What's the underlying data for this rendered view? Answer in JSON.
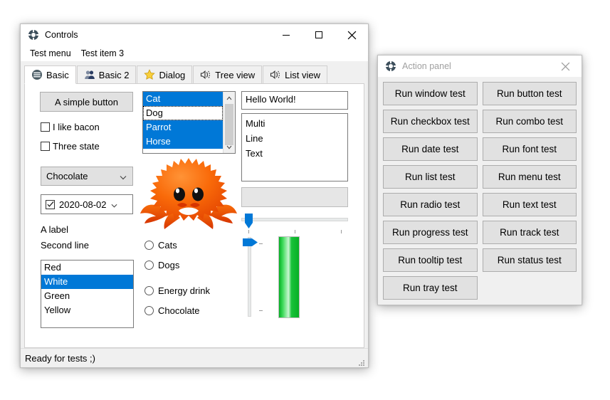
{
  "controls_window": {
    "title": "Controls",
    "title_icon": "gear-icon",
    "window_buttons": {
      "minimize": "minimize-icon",
      "maximize": "maximize-icon",
      "close": "close-icon"
    },
    "menu": [
      {
        "label": "Test menu"
      },
      {
        "label": "Test item 3"
      }
    ],
    "tabs": [
      {
        "label": "Basic",
        "icon": "layers-circle-icon",
        "active": true
      },
      {
        "label": "Basic 2",
        "icon": "people-icon",
        "active": false
      },
      {
        "label": "Dialog",
        "icon": "star-icon",
        "active": false
      },
      {
        "label": "Tree view",
        "icon": "speaker-icon",
        "active": false
      },
      {
        "label": "List view",
        "icon": "speaker-icon",
        "active": false
      }
    ],
    "basic_tab": {
      "push_button": {
        "label": "A simple button"
      },
      "checkboxes": [
        {
          "label": "I like bacon",
          "checked": false
        },
        {
          "label": "Three state",
          "checked": false
        }
      ],
      "combo": {
        "value": "Chocolate",
        "icon": "chevron-down-icon"
      },
      "date_picker": {
        "value": "2020-08-02",
        "checked": true,
        "icon": "chevron-down-icon"
      },
      "labels": [
        {
          "text": "A label"
        },
        {
          "text": "Second line"
        }
      ],
      "animal_list": {
        "items": [
          {
            "label": "Cat",
            "selected": true,
            "focused": false
          },
          {
            "label": "Dog",
            "selected": false,
            "focused": true
          },
          {
            "label": "Parrot",
            "selected": true,
            "focused": false
          },
          {
            "label": "Horse",
            "selected": true,
            "focused": false
          }
        ],
        "scroll_up_icon": "chevron-up-icon",
        "scroll_down_icon": "chevron-down-icon"
      },
      "color_list": {
        "items": [
          {
            "label": "Red",
            "selected": false
          },
          {
            "label": "White",
            "selected": true
          },
          {
            "label": "Green",
            "selected": false
          },
          {
            "label": "Yellow",
            "selected": false
          }
        ]
      },
      "radios": [
        {
          "label": "Cats",
          "checked": false
        },
        {
          "label": "Dogs",
          "checked": false
        },
        {
          "label": "Energy drink",
          "checked": false
        },
        {
          "label": "Chocolate",
          "checked": false
        }
      ],
      "text_field": {
        "value": "Hello World!",
        "placeholder": ""
      },
      "text_area": {
        "value": "Multi\nLine\nText",
        "placeholder": ""
      },
      "progress_bar_horizontal": {
        "percent": 0
      },
      "slider_horizontal": {
        "percent": 3
      },
      "slider_vertical": {
        "percent": 100
      },
      "progress_bar_vertical": {
        "percent": 100,
        "color": "#06b025"
      },
      "image": {
        "name": "ferris-crab-image",
        "color": "#f74c00"
      }
    },
    "statusbar": {
      "text": "Ready for tests ;)",
      "grip_icon": "resize-grip-icon"
    }
  },
  "action_panel": {
    "title": "Action panel",
    "title_icon": "gear-icon",
    "active": false,
    "window_buttons": {
      "close": "close-icon"
    },
    "buttons": [
      {
        "label": "Run window test"
      },
      {
        "label": "Run button test"
      },
      {
        "label": "Run checkbox test"
      },
      {
        "label": "Run combo test"
      },
      {
        "label": "Run date test"
      },
      {
        "label": "Run font test"
      },
      {
        "label": "Run list test"
      },
      {
        "label": "Run menu test"
      },
      {
        "label": "Run radio test"
      },
      {
        "label": "Run text test"
      },
      {
        "label": "Run progress test"
      },
      {
        "label": "Run track test"
      },
      {
        "label": "Run tooltip test"
      },
      {
        "label": "Run status test"
      },
      {
        "label": "Run tray test"
      }
    ]
  },
  "colors": {
    "accent": "#0078d7",
    "window_bg": "#f0f0f0",
    "button_face": "#e1e1e1",
    "progress_green": "#06b025",
    "crab_orange": "#f74c00"
  }
}
